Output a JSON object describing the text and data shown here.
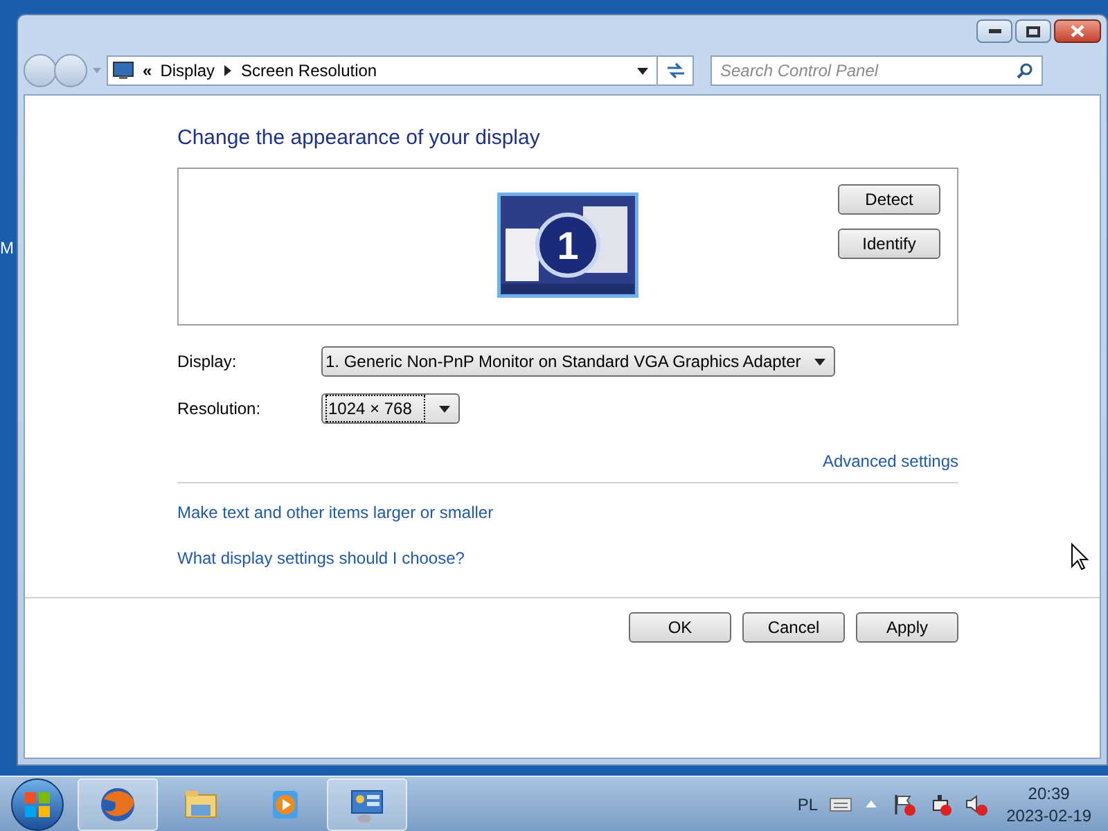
{
  "desktop": {
    "label": "M"
  },
  "address_bar": {
    "separator": "«",
    "crumbs": [
      "Display",
      "Screen Resolution"
    ],
    "search_placeholder": "Search Control Panel"
  },
  "heading": "Change the appearance of your display",
  "monitor": {
    "number": "1",
    "buttons": [
      "Detect",
      "Identify"
    ]
  },
  "fields": [
    {
      "label": "Display:",
      "value": "1. Generic Non-PnP Monitor on Standard VGA Graphics Adapter"
    },
    {
      "label": "Resolution:",
      "value": "1024 × 768"
    }
  ],
  "advanced_link": "Advanced settings",
  "links": [
    "Make text and other items larger or smaller",
    "What display settings should I choose?"
  ],
  "dialog_buttons": [
    "OK",
    "Cancel",
    "Apply"
  ],
  "taskbar": {
    "apps": [
      {
        "kind": "browser",
        "selected": true
      },
      {
        "kind": "folder",
        "selected": false
      },
      {
        "kind": "media",
        "selected": false
      },
      {
        "kind": "control",
        "selected": true
      }
    ],
    "language": "PL",
    "time": "20:39",
    "date": "2023-02-19"
  }
}
